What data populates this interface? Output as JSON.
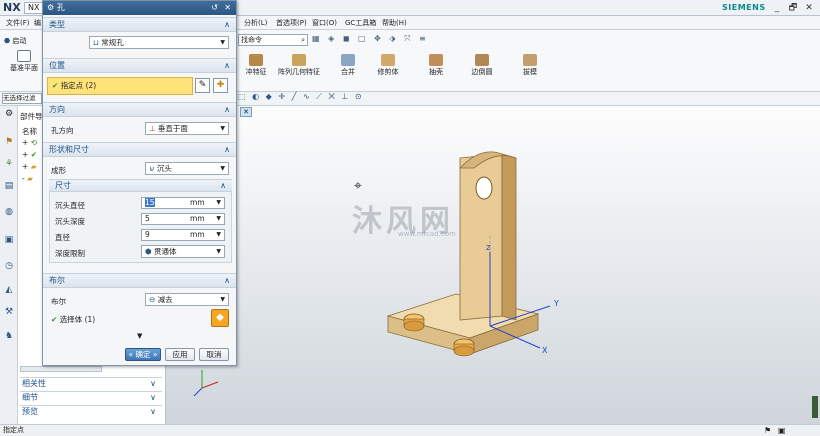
{
  "app": {
    "logo": "NX",
    "tab": "NX",
    "brand": "SIEMENS",
    "win_min": "_",
    "win_restore": "🗗",
    "win_close": "✕"
  },
  "menu": [
    "文件(F)",
    "编",
    "分析(L)",
    "首选项(P)",
    "窗口(O)",
    "GC工具箱",
    "帮助(H)"
  ],
  "ribbon": {
    "left_items": [
      "启动",
      "基准平面"
    ],
    "search_label": "找命令",
    "buttons": [
      "冲特征",
      "阵列几何特征",
      "合并",
      "修剪体",
      "抽壳",
      "边倒圆",
      "拔模"
    ]
  },
  "selection_filter": "无选择过滤器",
  "nav": {
    "header": "部件导",
    "column": "名称",
    "bottom_sections": [
      "相关性",
      "细节",
      "预览"
    ]
  },
  "dialog": {
    "title": "孔",
    "title_icon": "⚙",
    "title_reset": "↺",
    "title_close": "✕",
    "sections": {
      "type": {
        "title": "类型",
        "value": "常规孔"
      },
      "position": {
        "title": "位置",
        "label": "指定点 (2)"
      },
      "direction": {
        "title": "方向",
        "label": "孔方向",
        "value": "垂直于面"
      },
      "shape": {
        "title": "形状和尺寸",
        "form_label": "成形",
        "form_value": "沉头",
        "dims_title": "尺寸",
        "fields": [
          {
            "label": "沉头直径",
            "value": "15",
            "unit": "mm"
          },
          {
            "label": "沉头深度",
            "value": "5",
            "unit": "mm"
          },
          {
            "label": "直径",
            "value": "9",
            "unit": "mm"
          }
        ],
        "depth_label": "深度限制",
        "depth_value": "贯通体"
      },
      "boolean": {
        "title": "布尔",
        "label": "布尔",
        "value": "减去",
        "select_label": "选择体 (1)"
      }
    },
    "buttons": {
      "ok": "« 确定 »",
      "apply": "应用",
      "cancel": "取消"
    }
  },
  "watermark": {
    "main": "沐风网",
    "url": "www.mfcad.com"
  },
  "axes": {
    "x": "X",
    "y": "Y",
    "z": "Z"
  },
  "status": "指定点",
  "colors": {
    "title_blue": "#2c5684",
    "highlight_yellow": "#ffe27a",
    "part_tan": "#e4c690"
  }
}
